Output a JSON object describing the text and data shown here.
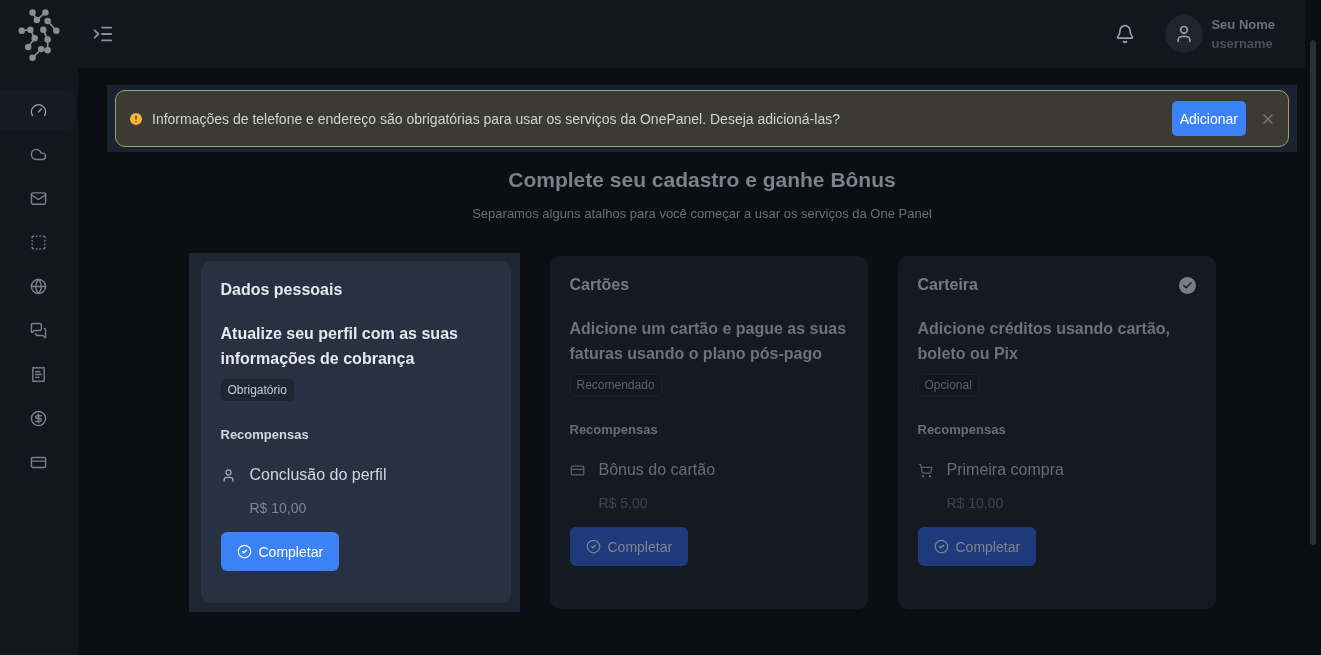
{
  "topbar": {
    "user": {
      "name": "Seu Nome",
      "username": "username"
    }
  },
  "sidebar": {
    "items": [
      {
        "kind": "dashboard",
        "selected": true
      },
      {
        "kind": "cloud",
        "selected": false
      },
      {
        "kind": "mail",
        "selected": false
      },
      {
        "kind": "frame",
        "selected": false
      },
      {
        "kind": "globe",
        "selected": false
      },
      {
        "kind": "chat",
        "selected": false
      },
      {
        "kind": "receipt",
        "selected": false
      },
      {
        "kind": "dollar",
        "selected": false
      },
      {
        "kind": "card",
        "selected": false
      }
    ]
  },
  "alert": {
    "message": "Informações de telefone e endereço são obrigatórias para usar os serviços da OnePanel. Deseja adicioná-las?",
    "button": "Adicionar"
  },
  "heading": {
    "title": "Complete seu cadastro e ganhe Bônus",
    "subtitle": "Separamos alguns atalhos para você começar a usar os serviços da One Panel"
  },
  "cards": [
    {
      "title": "Dados pessoais",
      "description": "Atualize seu perfil com as suas informações de cobrança",
      "tag": "Obrigatório",
      "rewards_label": "Recompensas",
      "reward": {
        "kind": "user",
        "name": "Conclusão do perfil",
        "value": "R$ 10,00"
      },
      "button": "Completar",
      "selected": true,
      "completed": false
    },
    {
      "title": "Cartões",
      "description": "Adicione um cartão e pague as suas faturas usando o plano pós-pago",
      "tag": "Recomendado",
      "rewards_label": "Recompensas",
      "reward": {
        "kind": "card",
        "name": "Bônus do cartão",
        "value": "R$ 5,00"
      },
      "button": "Completar",
      "selected": false,
      "completed": false
    },
    {
      "title": "Carteira",
      "description": "Adicione créditos usando cartão, boleto ou Pix",
      "tag": "Opcional",
      "rewards_label": "Recompensas",
      "reward": {
        "kind": "cart",
        "name": "Primeira compra",
        "value": "R$ 10,00"
      },
      "button": "Completar",
      "selected": false,
      "completed": true
    }
  ]
}
